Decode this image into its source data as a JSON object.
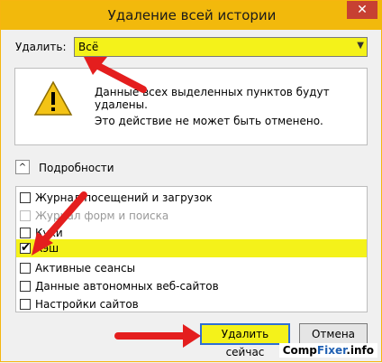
{
  "window": {
    "title": "Удаление всей истории",
    "close_glyph": "✕"
  },
  "range": {
    "label": "Удалить:",
    "value": "Всё"
  },
  "info": {
    "line1": "Данные всех выделенных пунктов будут",
    "line2": "удалены.",
    "line3": "Это действие не может быть отменено."
  },
  "details": {
    "label": "Подробности",
    "expander_glyph": "^"
  },
  "items": [
    {
      "label": "Журнал посещений и загрузок",
      "checked": false,
      "disabled": false
    },
    {
      "label": "Журнал форм и поиска",
      "checked": false,
      "disabled": true
    },
    {
      "label": "Куки",
      "checked": false,
      "disabled": false
    },
    {
      "label": "Кэш",
      "checked": true,
      "disabled": false
    },
    {
      "label": "Активные сеансы",
      "checked": false,
      "disabled": false
    },
    {
      "label": "Данные автономных веб-сайтов",
      "checked": false,
      "disabled": false
    },
    {
      "label": "Настройки сайтов",
      "checked": false,
      "disabled": false
    }
  ],
  "buttons": {
    "primary": "Удалить сейчас",
    "cancel": "Отмена"
  },
  "footer": {
    "part1": "Comp",
    "part2": "Fixer",
    "part3": ".info"
  },
  "colors": {
    "accent": "#f2b90c",
    "highlight": "#f4f21a",
    "annotation": "#e41e1e"
  }
}
